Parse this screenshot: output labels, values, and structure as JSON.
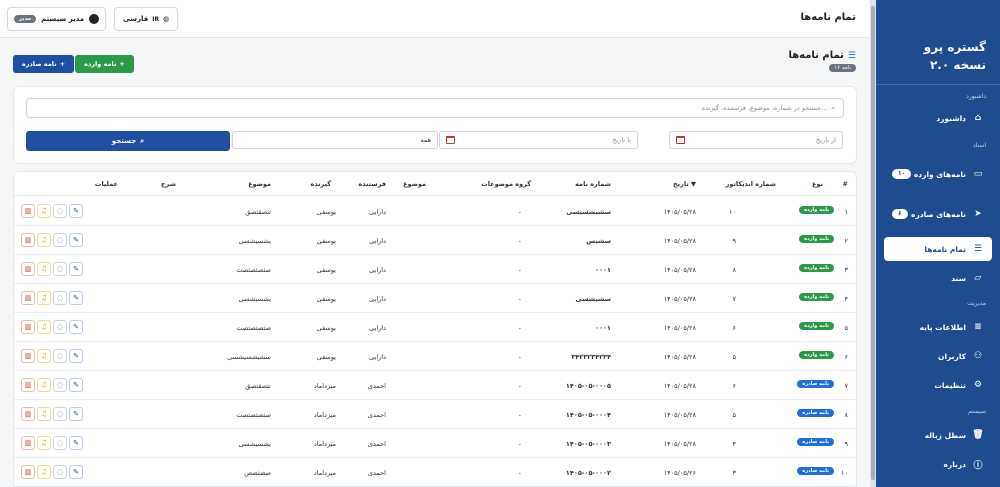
{
  "sidebar": {
    "brand_line1": "گستره پرو",
    "brand_line2": "نسخه ۲.۰",
    "sections": {
      "dashboard": "داشبورد",
      "documents": "اسناد",
      "management": "مدیریت",
      "system": "سیستم"
    },
    "items": [
      {
        "label": "داشبورد",
        "icon": "home-icon"
      },
      {
        "label": "نامه‌های وارده",
        "icon": "inbox-icon",
        "badge": "۱۰"
      },
      {
        "label": "نامه‌های صادره",
        "icon": "send-icon",
        "badge": "۶"
      },
      {
        "label": "تمام نامه‌ها",
        "icon": "list-icon",
        "active": true
      },
      {
        "label": "سند",
        "icon": "folder-icon"
      },
      {
        "label": "اطلاعات پایه",
        "icon": "database-icon"
      },
      {
        "label": "کاربران",
        "icon": "users-icon"
      },
      {
        "label": "تنظیمات",
        "icon": "gear-icon"
      },
      {
        "label": "سطل زباله",
        "icon": "trash-icon"
      },
      {
        "label": "درباره",
        "icon": "info-icon"
      }
    ]
  },
  "topbar": {
    "title": "تمام نامه‌ها",
    "user_name": "مدیر سیستم",
    "user_role": "مدیر",
    "language": "فارسی",
    "language_code": "IR"
  },
  "page": {
    "title": "تمام نامه‌ها",
    "count_badge": "۱۶ نامه",
    "btn_incoming": "نامه وارده",
    "btn_outgoing": "نامه صادره"
  },
  "filters": {
    "search_placeholder": "جستجو در شماره، موضوع، فرستنده، گیرنده...",
    "from_date_placeholder": "از تاریخ",
    "to_date_placeholder": "تا تاریخ",
    "type_value": "همه",
    "search_button": "جستجو"
  },
  "table": {
    "headers": {
      "num": "#",
      "type": "نوع",
      "indicator": "شماره اندیکاتور",
      "date": "تاریخ ▼",
      "letter_no": "شماره نامه",
      "subject_group": "گروه موضوعات",
      "subject": "موضوع",
      "sender": "فرستنده",
      "receiver": "گیرنده",
      "topic": "موضوع",
      "desc": "شرح",
      "actions": "عملیات"
    },
    "rows": [
      {
        "num": "۱",
        "type": "نامه وارده",
        "kind": "in",
        "indicator": "۱۰",
        "date": "۱۴۰۵/۰۵/۲۸",
        "letter_no": "سشیشسیسی",
        "subject_group": "-",
        "sender": "دارایی",
        "receiver": "یوسفی",
        "topic": "تثصقثصق"
      },
      {
        "num": "۲",
        "type": "نامه وارده",
        "kind": "in",
        "indicator": "۹",
        "date": "۱۴۰۵/۰۵/۲۸",
        "letter_no": "سشیس",
        "subject_group": "-",
        "sender": "دارایی",
        "receiver": "یوسفی",
        "topic": "یشسیشسی"
      },
      {
        "num": "۳",
        "type": "نامه وارده",
        "kind": "in",
        "indicator": "۸",
        "date": "۱۴۰۵/۰۵/۲۸",
        "letter_no": "۰۰۰۱",
        "subject_group": "-",
        "sender": "دارایی",
        "receiver": "یوسفی",
        "topic": "صثصثصثصت"
      },
      {
        "num": "۴",
        "type": "نامه وارده",
        "kind": "in",
        "indicator": "۷",
        "date": "۱۴۰۵/۰۵/۲۸",
        "letter_no": "سشیشسی",
        "subject_group": "-",
        "sender": "دارایی",
        "receiver": "یوسفی",
        "topic": "یشسیشسی"
      },
      {
        "num": "۵",
        "type": "نامه وارده",
        "kind": "in",
        "indicator": "۶",
        "date": "۱۴۰۵/۰۵/۲۸",
        "letter_no": "۰۰۰۱",
        "subject_group": "-",
        "sender": "دارایی",
        "receiver": "یوسفی",
        "topic": "صثصثصثصت"
      },
      {
        "num": "۶",
        "type": "نامه وارده",
        "kind": "in",
        "indicator": "۵",
        "date": "۱۴۰۵/۰۵/۲۸",
        "letter_no": "۳۴۲۳۲۳۴۲۳۴",
        "subject_group": "-",
        "sender": "دارایی",
        "receiver": "یوسفی",
        "topic": "سشیشسیشسی"
      },
      {
        "num": "۷",
        "type": "نامه صادره",
        "kind": "out",
        "indicator": "۶",
        "date": "۱۴۰۵/۰۵/۲۸",
        "letter_no": "۱۴۰۵-۰۵-۰۰۰۵",
        "subject_group": "-",
        "sender": "احمدی",
        "receiver": "میرداماد",
        "topic": "تثصقثصق"
      },
      {
        "num": "۸",
        "type": "نامه صادره",
        "kind": "out",
        "indicator": "۵",
        "date": "۱۴۰۵/۰۵/۲۸",
        "letter_no": "۱۴۰۵-۰۵-۰۰۰۴",
        "subject_group": "-",
        "sender": "احمدی",
        "receiver": "میرداماد",
        "topic": "صثصثصثصت"
      },
      {
        "num": "۹",
        "type": "نامه صادره",
        "kind": "out",
        "indicator": "۴",
        "date": "۱۴۰۵/۰۵/۲۸",
        "letter_no": "۱۴۰۵-۰۵-۰۰۰۳",
        "subject_group": "-",
        "sender": "احمدی",
        "receiver": "میرداماد",
        "topic": "یشسیشسی"
      },
      {
        "num": "۱۰",
        "type": "نامه صادره",
        "kind": "out",
        "indicator": "۳",
        "date": "۱۴۰۵/۰۵/۲۶",
        "letter_no": "۱۴۰۵-۰۵-۰۰۰۲",
        "subject_group": "-",
        "sender": "احمدی",
        "receiver": "میرداماد",
        "topic": "صضثضص"
      }
    ]
  }
}
